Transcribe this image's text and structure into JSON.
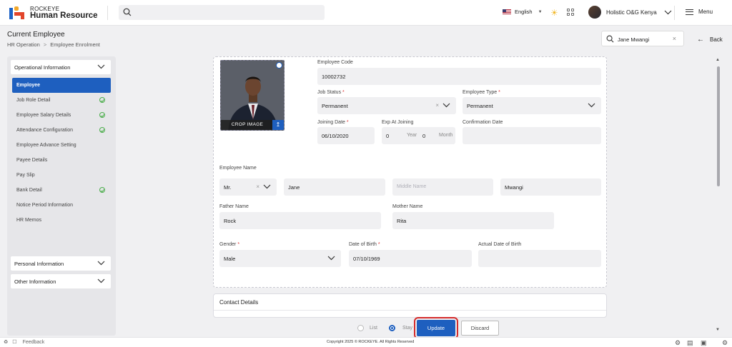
{
  "brand": {
    "line1": "ROCKEYE",
    "line2": "Human Resource"
  },
  "topbar": {
    "language": "English",
    "user_name": "Holistic O&G Kenya",
    "menu_label": "Menu"
  },
  "header": {
    "title": "Current Employee",
    "breadcrumb": [
      "HR Operation",
      "Employee Enrolment"
    ],
    "employee_search": "Jane Mwangi",
    "back_label": "Back"
  },
  "sidebar": {
    "sections": {
      "operational": "Operational Information",
      "personal": "Personal Information",
      "other": "Other Information"
    },
    "items": [
      {
        "label": "Employee",
        "active": true,
        "done": false
      },
      {
        "label": "Job Role Detail",
        "active": false,
        "done": true
      },
      {
        "label": "Employee Salary Details",
        "active": false,
        "done": true
      },
      {
        "label": "Attendance Configuration",
        "active": false,
        "done": true
      },
      {
        "label": "Employee Advance Setting",
        "active": false,
        "done": false
      },
      {
        "label": "Payee Details",
        "active": false,
        "done": false
      },
      {
        "label": "Pay Slip",
        "active": false,
        "done": false
      },
      {
        "label": "Bank Detail",
        "active": false,
        "done": true
      },
      {
        "label": "Notice Period Information",
        "active": false,
        "done": false
      },
      {
        "label": "HR Memos",
        "active": false,
        "done": false
      }
    ]
  },
  "photo": {
    "crop_label": "CROP IMAGE"
  },
  "form": {
    "employee_code": {
      "label": "Employee Code",
      "value": "10002732"
    },
    "job_status": {
      "label": "Job Status",
      "value": "Permanent"
    },
    "employee_type": {
      "label": "Employee Type",
      "value": "Permanent"
    },
    "joining_date": {
      "label": "Joining Date",
      "value": "06/10/2020"
    },
    "exp_at_joining": {
      "label": "Exp At Joining",
      "years": "0",
      "year_unit": "Year",
      "months": "0",
      "month_unit": "Month"
    },
    "confirmation_date": {
      "label": "Confirmation Date",
      "value": ""
    },
    "employee_name_label": "Employee Name",
    "salutation": "Mr.",
    "first_name": "Jane",
    "middle_name_placeholder": "Middle Name",
    "last_name": "Mwangi",
    "father_name": {
      "label": "Father Name",
      "value": "Rock"
    },
    "mother_name": {
      "label": "Mother Name",
      "value": "Rita"
    },
    "gender": {
      "label": "Gender",
      "value": "Male"
    },
    "dob": {
      "label": "Date of Birth",
      "value": "07/10/1969"
    },
    "actual_dob": {
      "label": "Actual Date of Birth",
      "value": ""
    }
  },
  "contact": {
    "title": "Contact Details"
  },
  "actions": {
    "list": "List",
    "stay": "Stay",
    "update": "Update",
    "discard": "Discard"
  },
  "footer": {
    "feedback": "Feedback",
    "copyright": "Copyright 2025 © ROCKEYE. All Rights Reserved"
  },
  "colors": {
    "primary": "#1e5fbf",
    "highlight": "#d42b2b",
    "check": "#4cae4c"
  }
}
